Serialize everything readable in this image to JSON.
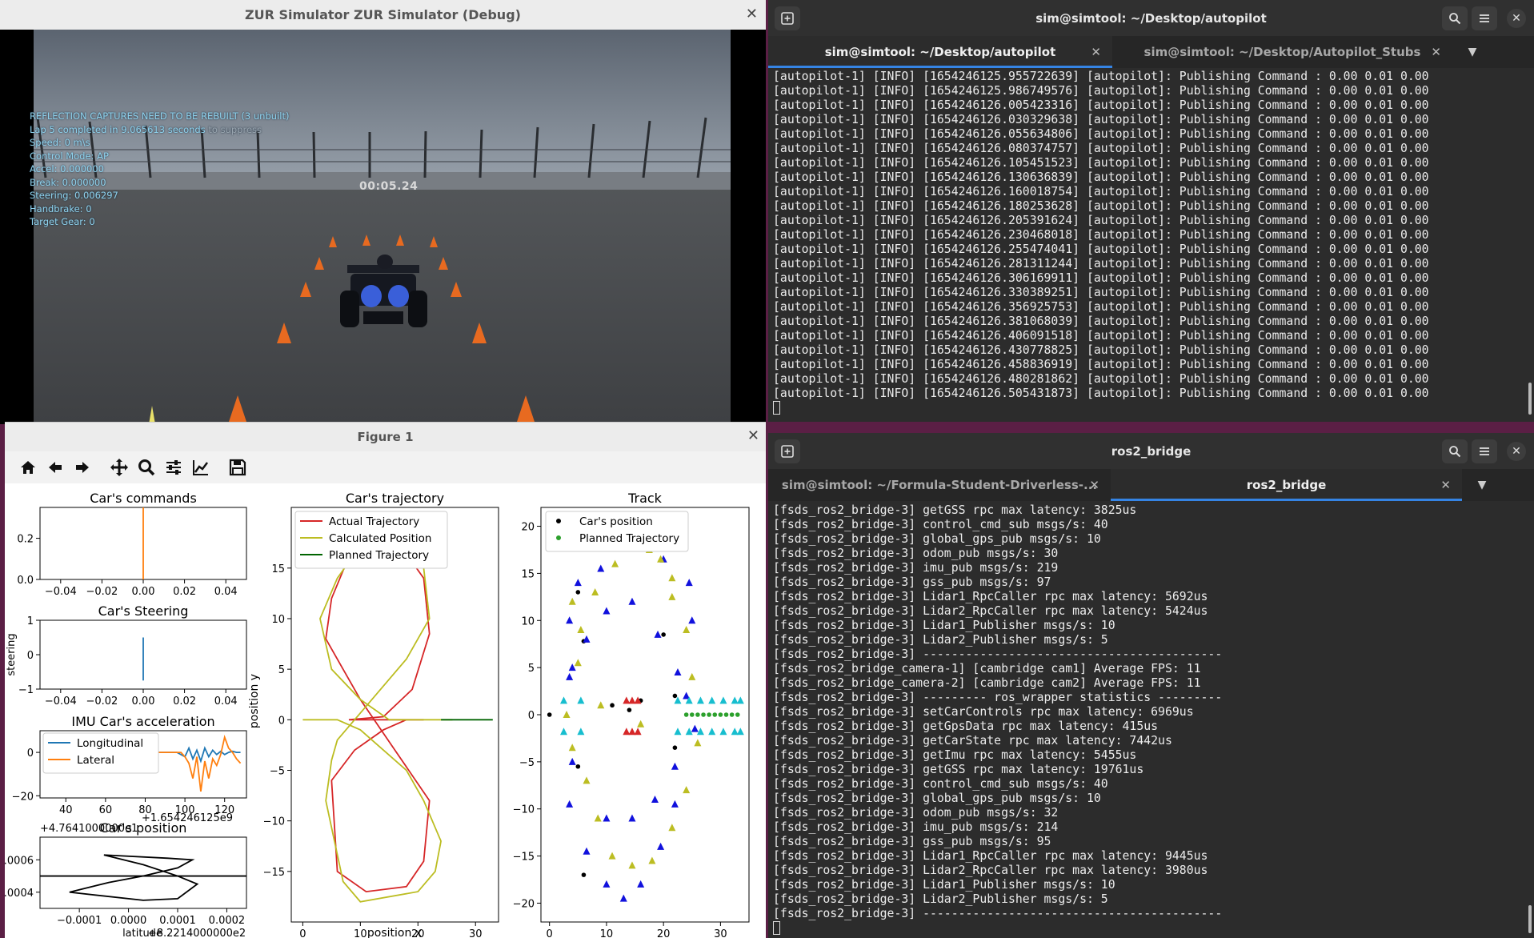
{
  "simulator": {
    "title": "ZUR Simulator ZUR Simulator (Debug)",
    "hud_lines": [
      "REFLECTION CAPTURES NEED TO BE REBUILT (3 unbuilt)",
      "Lap 5 completed in 9.065613 seconds",
      "Speed: 0 m\\s",
      "Control Mode: AP",
      "Accel: 0.000000",
      "Break: 0.000000",
      "Steering: 0.006297",
      "Handbrake: 0",
      "Target Gear: 0"
    ],
    "hud_suffix": "to suppress",
    "timer": "00:05.24"
  },
  "figure": {
    "title": "Figure 1",
    "toolbar_icons": [
      "home-icon",
      "back-arrow-icon",
      "forward-arrow-icon",
      "pan-icon",
      "zoom-icon",
      "configure-subplots-icon",
      "edit-axis-icon",
      "save-icon"
    ],
    "commands_title": "Car's commands",
    "steering_title": "Car's Steering",
    "steering_ylabel": "steering",
    "imu_title": "IMU Car's acceleration",
    "imu_offset": "+1.654246125e9",
    "imu_legend": [
      "Longitudinal",
      "Lateral"
    ],
    "gps_title": "Car's position",
    "gps_yoffset": "+4.7641000000e1",
    "gps_xoffset": "+8.2214000000e2",
    "gps_xlabel": "latitude",
    "trajectory_title": "Car's trajectory",
    "trajectory_legend": [
      "Actual Trajectory",
      "Calculated Position",
      "Planned Trajectory"
    ],
    "trajectory_xlabel": "position x",
    "trajectory_ylabel": "position y",
    "track_title": "Track",
    "track_legend": [
      "Car's position",
      "Planned Trajectory"
    ]
  },
  "chart_data": [
    {
      "type": "line",
      "title": "Car's commands",
      "xlim": [
        -0.05,
        0.05
      ],
      "ylim": [
        0.0,
        0.35
      ],
      "xticks": [
        -0.04,
        -0.02,
        0.0,
        0.02,
        0.04
      ],
      "yticks": [
        0.0,
        0.2
      ],
      "series": [
        {
          "color": "#ff7f0e",
          "x": [
            0,
            0
          ],
          "y": [
            0.0,
            0.35
          ]
        }
      ]
    },
    {
      "type": "line",
      "title": "Car's Steering",
      "ylabel": "steering",
      "xlim": [
        -0.05,
        0.05
      ],
      "ylim": [
        -1,
        1
      ],
      "xticks": [
        -0.04,
        -0.02,
        0.0,
        0.02,
        0.04
      ],
      "yticks": [
        -1,
        0,
        1
      ],
      "series": [
        {
          "color": "#1f77b4",
          "x": [
            0,
            0
          ],
          "y": [
            -0.75,
            0.5
          ]
        }
      ]
    },
    {
      "type": "line",
      "title": "IMU Car's acceleration",
      "xlim": [
        27,
        131
      ],
      "ylim": [
        -21,
        10
      ],
      "xticks": [
        40,
        60,
        80,
        100,
        120
      ],
      "yticks": [
        -20,
        0
      ],
      "series": [
        {
          "name": "Longitudinal",
          "color": "#1f77b4",
          "x": [
            80,
            96,
            100,
            102,
            104,
            106,
            108,
            110,
            112,
            114,
            116,
            118,
            120,
            122,
            124,
            126,
            128
          ],
          "y": [
            0,
            0,
            -2,
            2,
            -3,
            1,
            -4,
            2,
            -2,
            1,
            -1,
            0.5,
            -1,
            0,
            0.5,
            0,
            0
          ]
        },
        {
          "name": "Lateral",
          "color": "#ff7f0e",
          "x": [
            80,
            98,
            100,
            102,
            104,
            106,
            108,
            110,
            112,
            114,
            116,
            118,
            120,
            122,
            124,
            126,
            128
          ],
          "y": [
            0,
            0,
            -2,
            -5,
            -12,
            -2,
            -18,
            -4,
            -12,
            -3,
            -6,
            -1,
            7,
            2,
            0,
            -3,
            -5
          ]
        }
      ]
    },
    {
      "type": "line",
      "title": "Car's position",
      "xlabel": "latitude",
      "xlim": [
        -0.00018,
        0.00024
      ],
      "ylim": [
        0.0003,
        0.00074
      ],
      "xticks": [
        -0.0001,
        0.0,
        0.0001,
        0.0002
      ],
      "yticks": [
        0.0004,
        0.0006
      ],
      "series": [
        {
          "color": "#000000",
          "x": [
            -0.00018,
            0.00024
          ],
          "y": [
            0.0005,
            0.0005
          ]
        },
        {
          "color": "#000000",
          "x": [
            -5e-05,
            3e-05,
            0.0001,
            0.00014,
            0.0001,
            3e-05,
            -0.00012,
            -4e-05,
            3e-05,
            0.0001,
            0.00013,
            8e-05,
            -5e-05
          ],
          "y": [
            0.00063,
            0.00057,
            0.0005,
            0.00045,
            0.00036,
            0.00035,
            0.0004,
            0.00046,
            0.0005,
            0.00055,
            0.0006,
            0.00061,
            0.00063
          ]
        }
      ]
    },
    {
      "type": "line",
      "title": "Car's trajectory",
      "xlabel": "position x",
      "ylabel": "position y",
      "xlim": [
        -2,
        34
      ],
      "ylim": [
        -20,
        21
      ],
      "xticks": [
        0,
        10,
        20,
        30
      ],
      "yticks": [
        -15,
        -10,
        -5,
        0,
        5,
        10,
        15
      ],
      "series": [
        {
          "name": "Actual Trajectory",
          "color": "#d62728",
          "x": [
            8,
            14,
            19,
            22,
            21,
            16,
            12,
            9,
            5,
            4,
            7,
            10,
            16,
            22,
            21,
            18,
            11,
            6,
            5,
            9,
            14,
            18,
            21,
            18,
            13,
            8
          ],
          "y": [
            0,
            0.3,
            3,
            8.5,
            14,
            18,
            18.5,
            17.5,
            12,
            8,
            5,
            2,
            -3,
            -8,
            -14,
            -16.5,
            -17,
            -15,
            -6,
            -3,
            -1,
            0,
            0,
            0,
            0,
            0
          ]
        },
        {
          "name": "Calculated Position",
          "color": "#bcbd22",
          "x": [
            0,
            6,
            10,
            14,
            18,
            21,
            24,
            23,
            20,
            10,
            7,
            4,
            5,
            6,
            12,
            18,
            22,
            21,
            14,
            11,
            6,
            3,
            5,
            10,
            15,
            20,
            23,
            26
          ],
          "y": [
            0,
            0,
            -1,
            -3,
            -5,
            -8,
            -12,
            -15,
            -17,
            -18,
            -16,
            -8,
            -4,
            -2,
            2,
            6,
            10,
            15,
            19,
            18,
            14,
            10,
            5,
            2,
            0,
            0,
            0,
            0
          ]
        },
        {
          "name": "Planned Trajectory",
          "color": "#006400",
          "x": [
            24,
            33
          ],
          "y": [
            0,
            0
          ]
        }
      ]
    },
    {
      "type": "scatter",
      "title": "Track",
      "xlim": [
        -1.5,
        35
      ],
      "ylim": [
        -22,
        22
      ],
      "xticks": [
        0,
        10,
        20,
        30
      ],
      "yticks": [
        -20,
        -15,
        -10,
        -5,
        0,
        5,
        10,
        15,
        20
      ],
      "series": [
        {
          "name": "Car's position",
          "color": "#000000",
          "x": [
            0,
            5,
            6,
            11,
            14,
            16,
            20,
            22,
            22,
            5,
            6
          ],
          "y": [
            0,
            13,
            7.8,
            1,
            0.5,
            1.5,
            8.5,
            2,
            -3.5,
            -5.5,
            -17
          ],
          "marker": "dot"
        },
        {
          "name": "Planned Trajectory",
          "color": "#2ca02c",
          "x": [
            24,
            25,
            26,
            27,
            28,
            29,
            30,
            31,
            32,
            33
          ],
          "y": [
            0,
            0,
            0,
            0,
            0,
            0,
            0,
            0,
            0,
            0
          ],
          "marker": "dot"
        },
        {
          "color": "#1111dd",
          "marker": "triangle",
          "x": [
            3.5,
            6.5,
            10.0,
            13.0,
            16.0,
            19.5,
            22.0,
            4.0,
            3.5,
            5.0,
            9.0,
            20.0,
            24.5,
            25.0,
            3.5,
            4.0,
            6.5,
            10.0,
            14.5,
            19.0,
            22.5,
            24.0,
            25.5,
            22.0,
            18.5,
            14.5,
            10.0
          ],
          "y": [
            -9.5,
            -14.5,
            -18.0,
            -19.5,
            -18.0,
            -14.0,
            -9.5,
            -5.0,
            10.0,
            14.0,
            15.5,
            16.5,
            14.0,
            10.0,
            4.0,
            5.0,
            8.0,
            11.0,
            12.0,
            8.5,
            4.5,
            2.0,
            -1.5,
            -5.5,
            -9.0,
            -11.0,
            -11.0
          ]
        },
        {
          "color": "#bcbd22",
          "marker": "triangle",
          "x": [
            3.0,
            4.0,
            6.5,
            8.5,
            11.0,
            14.5,
            18.0,
            21.5,
            24.0,
            26.0,
            25.0,
            24.0,
            21.5,
            21.5,
            19.5,
            17.5,
            14.5,
            11.5,
            8.0,
            5.5,
            5.0,
            4.0,
            2.5,
            9.0,
            16.0
          ],
          "y": [
            0.0,
            -3.5,
            -7.0,
            -11.0,
            -15.0,
            -16.0,
            -15.5,
            -12.0,
            -8.0,
            -3.0,
            4.0,
            9.0,
            12.5,
            14.5,
            16.5,
            17.5,
            18.0,
            16.0,
            13.0,
            9.0,
            5.5,
            12.0,
            18.5,
            1.0,
            -1.0
          ]
        },
        {
          "color": "#d62728",
          "marker": "triangle",
          "x": [
            13.5,
            14.5,
            15.5,
            13.5,
            14.5,
            15.5
          ],
          "y": [
            1.5,
            1.5,
            1.5,
            -1.8,
            -1.8,
            -1.8
          ]
        },
        {
          "color": "#17becf",
          "marker": "triangle",
          "x": [
            2.5,
            5.5,
            22.5,
            24.5,
            26.5,
            28.5,
            30.5,
            32.5,
            33.5,
            2.5,
            5.5,
            22.5,
            24.5,
            26.5,
            28.5,
            30.5,
            32.5,
            33.5
          ],
          "y": [
            1.5,
            1.5,
            1.5,
            1.5,
            1.5,
            1.5,
            1.5,
            1.5,
            1.5,
            -1.8,
            -1.8,
            -1.8,
            -1.8,
            -1.8,
            -1.8,
            -1.8,
            -1.8,
            -1.8
          ]
        }
      ]
    }
  ],
  "terminal_top": {
    "title": "sim@simtool: ~/Desktop/autopilot",
    "tabs": [
      {
        "label": "sim@simtool: ~/Desktop/autopilot"
      },
      {
        "label": "sim@simtool: ~/Desktop/Autopilot_Stubs"
      }
    ],
    "lines": [
      "[autopilot-1] [INFO] [1654246125.955722639] [autopilot]: Publishing Command : 0.00 0.01 0.00",
      "[autopilot-1] [INFO] [1654246125.986749576] [autopilot]: Publishing Command : 0.00 0.01 0.00",
      "[autopilot-1] [INFO] [1654246126.005423316] [autopilot]: Publishing Command : 0.00 0.01 0.00",
      "[autopilot-1] [INFO] [1654246126.030329638] [autopilot]: Publishing Command : 0.00 0.01 0.00",
      "[autopilot-1] [INFO] [1654246126.055634806] [autopilot]: Publishing Command : 0.00 0.01 0.00",
      "[autopilot-1] [INFO] [1654246126.080374757] [autopilot]: Publishing Command : 0.00 0.01 0.00",
      "[autopilot-1] [INFO] [1654246126.105451523] [autopilot]: Publishing Command : 0.00 0.01 0.00",
      "[autopilot-1] [INFO] [1654246126.130636839] [autopilot]: Publishing Command : 0.00 0.01 0.00",
      "[autopilot-1] [INFO] [1654246126.160018754] [autopilot]: Publishing Command : 0.00 0.01 0.00",
      "[autopilot-1] [INFO] [1654246126.180253628] [autopilot]: Publishing Command : 0.00 0.01 0.00",
      "[autopilot-1] [INFO] [1654246126.205391624] [autopilot]: Publishing Command : 0.00 0.01 0.00",
      "[autopilot-1] [INFO] [1654246126.230468018] [autopilot]: Publishing Command : 0.00 0.01 0.00",
      "[autopilot-1] [INFO] [1654246126.255474041] [autopilot]: Publishing Command : 0.00 0.01 0.00",
      "[autopilot-1] [INFO] [1654246126.281311244] [autopilot]: Publishing Command : 0.00 0.01 0.00",
      "[autopilot-1] [INFO] [1654246126.306169911] [autopilot]: Publishing Command : 0.00 0.01 0.00",
      "[autopilot-1] [INFO] [1654246126.330389251] [autopilot]: Publishing Command : 0.00 0.01 0.00",
      "[autopilot-1] [INFO] [1654246126.356925753] [autopilot]: Publishing Command : 0.00 0.01 0.00",
      "[autopilot-1] [INFO] [1654246126.381068039] [autopilot]: Publishing Command : 0.00 0.01 0.00",
      "[autopilot-1] [INFO] [1654246126.406091518] [autopilot]: Publishing Command : 0.00 0.01 0.00",
      "[autopilot-1] [INFO] [1654246126.430778825] [autopilot]: Publishing Command : 0.00 0.01 0.00",
      "[autopilot-1] [INFO] [1654246126.458836919] [autopilot]: Publishing Command : 0.00 0.01 0.00",
      "[autopilot-1] [INFO] [1654246126.480281862] [autopilot]: Publishing Command : 0.00 0.01 0.00",
      "[autopilot-1] [INFO] [1654246126.505431873] [autopilot]: Publishing Command : 0.00 0.01 0.00"
    ]
  },
  "terminal_bottom": {
    "title": "ros2_bridge",
    "tabs": [
      {
        "label": "sim@simtool: ~/Formula-Student-Driverless-..."
      },
      {
        "label": "ros2_bridge"
      }
    ],
    "lines": [
      "[fsds_ros2_bridge-3] getGSS rpc max latency: 3825us",
      "[fsds_ros2_bridge-3] control_cmd_sub msgs/s: 40",
      "[fsds_ros2_bridge-3] global_gps_pub msgs/s: 10",
      "[fsds_ros2_bridge-3] odom_pub msgs/s: 30",
      "[fsds_ros2_bridge-3] imu_pub msgs/s: 219",
      "[fsds_ros2_bridge-3] gss_pub msgs/s: 97",
      "[fsds_ros2_bridge-3] Lidar1_RpcCaller rpc max latency: 5692us",
      "[fsds_ros2_bridge-3] Lidar2_RpcCaller rpc max latency: 5424us",
      "[fsds_ros2_bridge-3] Lidar1_Publisher msgs/s: 10",
      "[fsds_ros2_bridge-3] Lidar2_Publisher msgs/s: 5",
      "[fsds_ros2_bridge-3] ------------------------------------------",
      "[fsds_ros2_bridge_camera-1] [cambridge cam1] Average FPS: 11",
      "[fsds_ros2_bridge_camera-2] [cambridge cam2] Average FPS: 11",
      "[fsds_ros2_bridge-3] --------- ros_wrapper statistics ---------",
      "[fsds_ros2_bridge-3] setCarControls rpc max latency: 6969us",
      "[fsds_ros2_bridge-3] getGpsData rpc max latency: 415us",
      "[fsds_ros2_bridge-3] getCarState rpc max latency: 7442us",
      "[fsds_ros2_bridge-3] getImu rpc max latency: 5455us",
      "[fsds_ros2_bridge-3] getGSS rpc max latency: 19761us",
      "[fsds_ros2_bridge-3] control_cmd_sub msgs/s: 40",
      "[fsds_ros2_bridge-3] global_gps_pub msgs/s: 10",
      "[fsds_ros2_bridge-3] odom_pub msgs/s: 32",
      "[fsds_ros2_bridge-3] imu_pub msgs/s: 214",
      "[fsds_ros2_bridge-3] gss_pub msgs/s: 95",
      "[fsds_ros2_bridge-3] Lidar1_RpcCaller rpc max latency: 9445us",
      "[fsds_ros2_bridge-3] Lidar2_RpcCaller rpc max latency: 3980us",
      "[fsds_ros2_bridge-3] Lidar1_Publisher msgs/s: 10",
      "[fsds_ros2_bridge-3] Lidar2_Publisher msgs/s: 5",
      "[fsds_ros2_bridge-3] ------------------------------------------"
    ]
  },
  "colors": {
    "desktop": "#5b1f45",
    "terminal_bg": "#2c2c2c",
    "tab_accent": "#3584e4",
    "hud_text": "#8fd3ee"
  }
}
